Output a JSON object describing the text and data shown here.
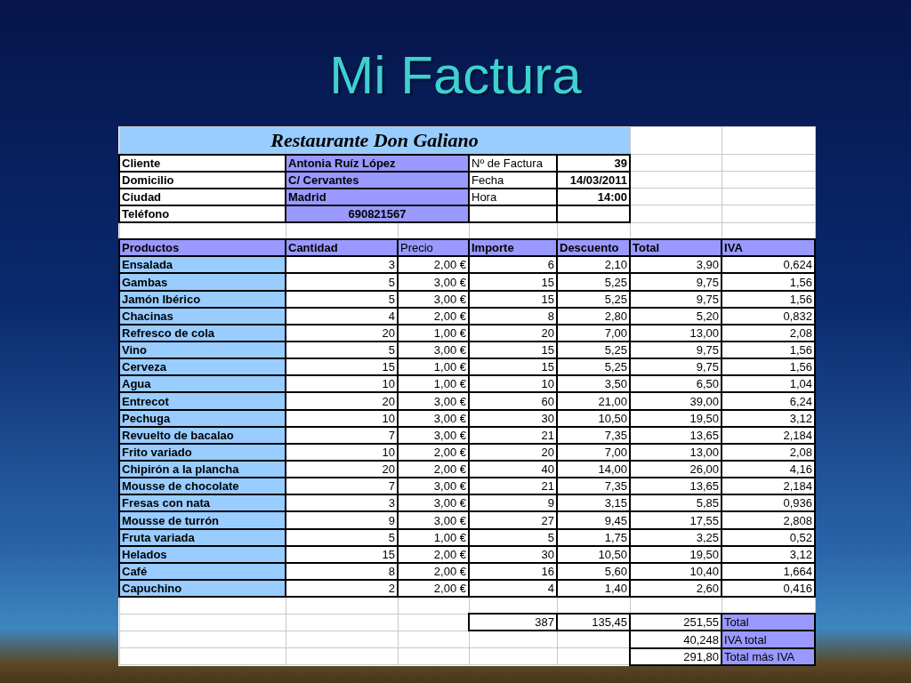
{
  "slide": {
    "title": "Mi Factura"
  },
  "sheet": {
    "restaurant": "Restaurante Don Galiano",
    "client_fields": [
      {
        "label": "Cliente",
        "value": "Antonia Ruíz López",
        "kind": "text"
      },
      {
        "label": "Domicilio",
        "value": "C/ Cervantes",
        "kind": "text"
      },
      {
        "label": "Ciudad",
        "value": "Madrid",
        "kind": "text"
      },
      {
        "label": "Teléfono",
        "value": "690821567",
        "kind": "phone"
      }
    ],
    "invoice_fields": [
      {
        "label": "Nº de Factura",
        "value": "39"
      },
      {
        "label": "Fecha",
        "value": "14/03/2011"
      },
      {
        "label": "Hora",
        "value": "14:00"
      }
    ],
    "columns": [
      {
        "label": "Productos",
        "bold": true
      },
      {
        "label": "Cantidad",
        "bold": true
      },
      {
        "label": "Precio",
        "bold": false
      },
      {
        "label": "Importe",
        "bold": true
      },
      {
        "label": "Descuento",
        "bold": true
      },
      {
        "label": "Total",
        "bold": true
      },
      {
        "label": "IVA",
        "bold": true
      }
    ],
    "rows": [
      [
        "Ensalada",
        "3",
        "2,00 €",
        "6",
        "2,10",
        "3,90",
        "0,624"
      ],
      [
        "Gambas",
        "5",
        "3,00 €",
        "15",
        "5,25",
        "9,75",
        "1,56"
      ],
      [
        "Jamón Ibérico",
        "5",
        "3,00 €",
        "15",
        "5,25",
        "9,75",
        "1,56"
      ],
      [
        "Chacinas",
        "4",
        "2,00 €",
        "8",
        "2,80",
        "5,20",
        "0,832"
      ],
      [
        "Refresco de cola",
        "20",
        "1,00 €",
        "20",
        "7,00",
        "13,00",
        "2,08"
      ],
      [
        "Vino",
        "5",
        "3,00 €",
        "15",
        "5,25",
        "9,75",
        "1,56"
      ],
      [
        "Cerveza",
        "15",
        "1,00 €",
        "15",
        "5,25",
        "9,75",
        "1,56"
      ],
      [
        "Agua",
        "10",
        "1,00 €",
        "10",
        "3,50",
        "6,50",
        "1,04"
      ],
      [
        "Entrecot",
        "20",
        "3,00 €",
        "60",
        "21,00",
        "39,00",
        "6,24"
      ],
      [
        "Pechuga",
        "10",
        "3,00 €",
        "30",
        "10,50",
        "19,50",
        "3,12"
      ],
      [
        "Revuelto de bacalao",
        "7",
        "3,00 €",
        "21",
        "7,35",
        "13,65",
        "2,184"
      ],
      [
        "Frito variado",
        "10",
        "2,00 €",
        "20",
        "7,00",
        "13,00",
        "2,08"
      ],
      [
        "Chipirón a la plancha",
        "20",
        "2,00 €",
        "40",
        "14,00",
        "26,00",
        "4,16"
      ],
      [
        "Mousse de chocolate",
        "7",
        "3,00 €",
        "21",
        "7,35",
        "13,65",
        "2,184"
      ],
      [
        "Fresas con nata",
        "3",
        "3,00 €",
        "9",
        "3,15",
        "5,85",
        "0,936"
      ],
      [
        "Mousse de turrón",
        "9",
        "3,00 €",
        "27",
        "9,45",
        "17,55",
        "2,808"
      ],
      [
        "Fruta variada",
        "5",
        "1,00 €",
        "5",
        "1,75",
        "3,25",
        "0,52"
      ],
      [
        "Helados",
        "15",
        "2,00 €",
        "30",
        "10,50",
        "19,50",
        "3,12"
      ],
      [
        "Café",
        "8",
        "2,00 €",
        "16",
        "5,60",
        "10,40",
        "1,664"
      ],
      [
        "Capuchino",
        "2",
        "2,00 €",
        "4",
        "1,40",
        "2,60",
        "0,416"
      ]
    ],
    "summary": [
      {
        "importe": "387",
        "descuento": "135,45",
        "total": "251,55",
        "label": "Total"
      },
      {
        "total": "40,248",
        "label": "IVA total"
      },
      {
        "total": "291,80",
        "label": "Total más IVA"
      }
    ]
  }
}
